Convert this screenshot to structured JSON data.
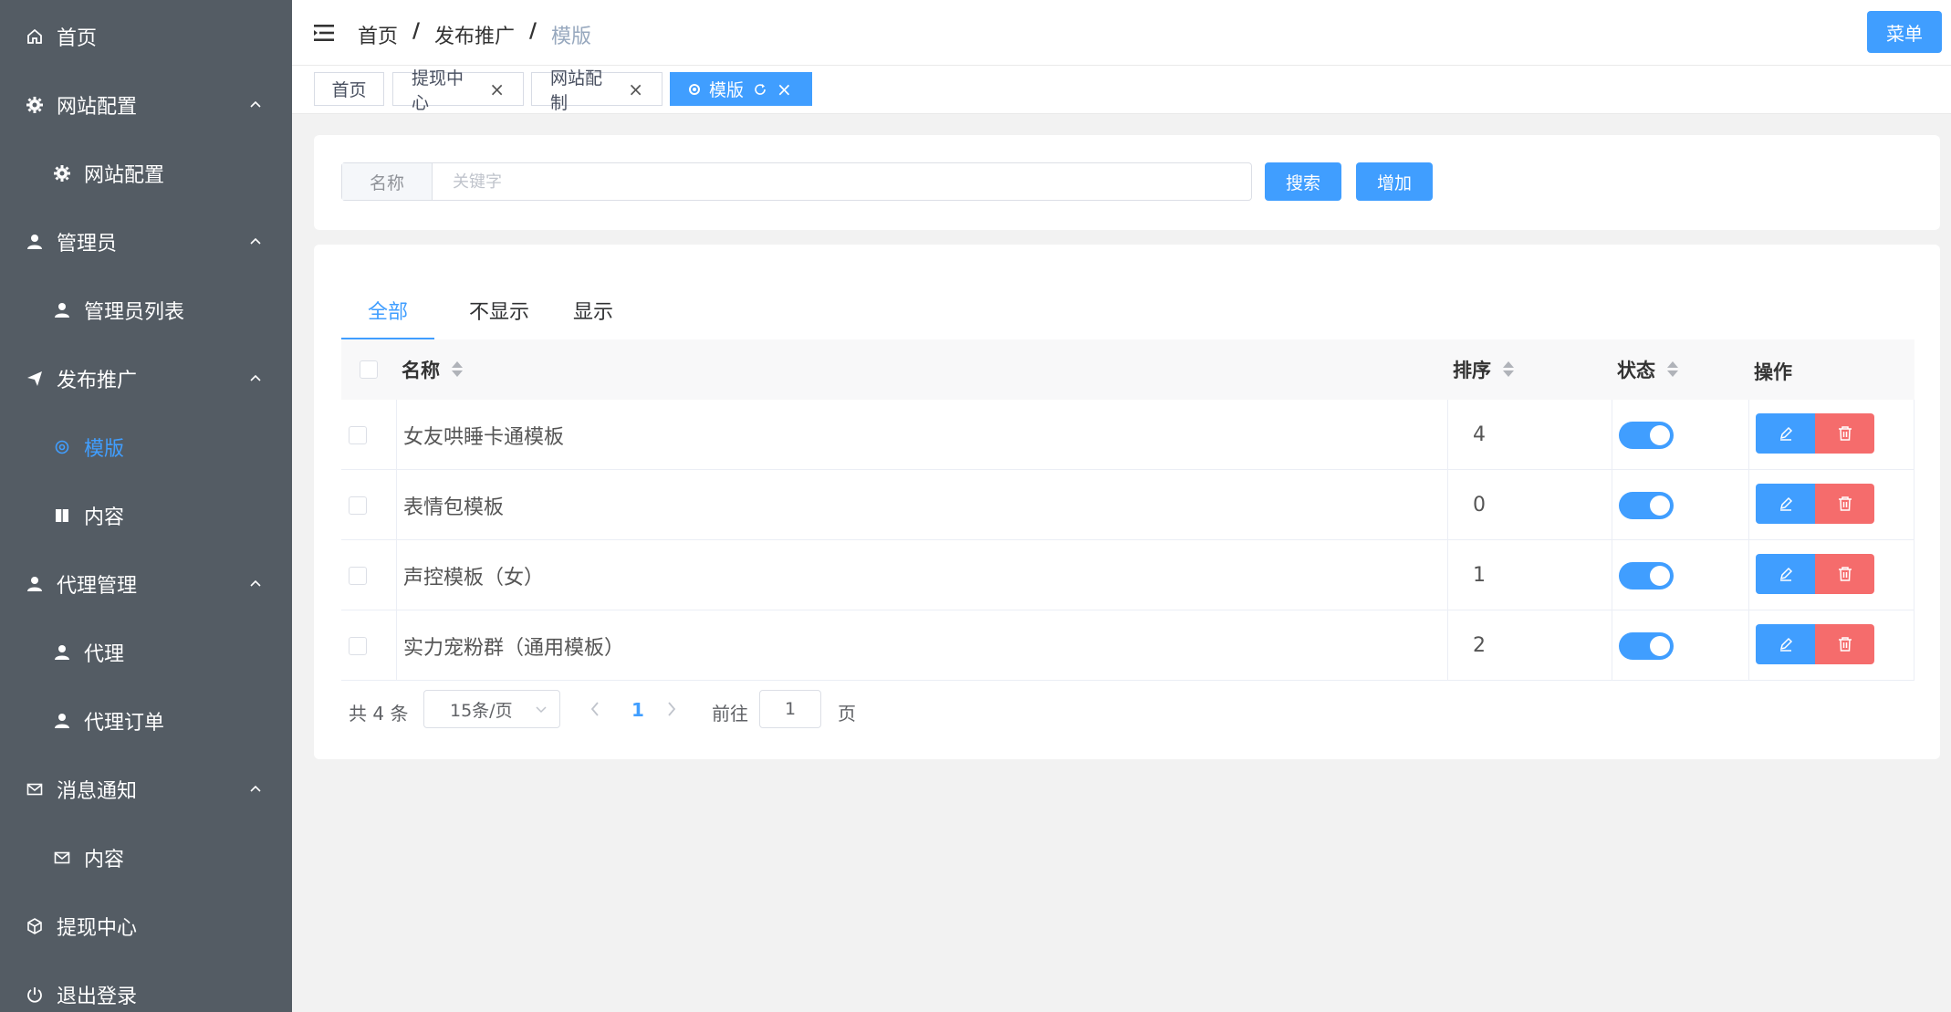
{
  "sidebar": {
    "items": [
      {
        "label": "首页"
      },
      {
        "label": "网站配置"
      },
      {
        "label": "网站配置"
      },
      {
        "label": "管理员"
      },
      {
        "label": "管理员列表"
      },
      {
        "label": "发布推广"
      },
      {
        "label": "模版"
      },
      {
        "label": "内容"
      },
      {
        "label": "代理管理"
      },
      {
        "label": "代理"
      },
      {
        "label": "代理订单"
      },
      {
        "label": "消息通知"
      },
      {
        "label": "内容"
      },
      {
        "label": "提现中心"
      },
      {
        "label": "退出登录"
      }
    ]
  },
  "header": {
    "breadcrumb": [
      "首页",
      "发布推广",
      "模版"
    ],
    "menu_label": "菜单"
  },
  "tags": [
    {
      "label": "首页"
    },
    {
      "label": "提现中心"
    },
    {
      "label": "网站配制"
    },
    {
      "label": "模版"
    }
  ],
  "search": {
    "label": "名称",
    "placeholder": "关键字",
    "search_label": "搜索",
    "add_label": "增加"
  },
  "tabs": [
    {
      "label": "全部"
    },
    {
      "label": "不显示"
    },
    {
      "label": "显示"
    }
  ],
  "table": {
    "columns": {
      "name": "名称",
      "sort": "排序",
      "status": "状态",
      "actions": "操作"
    },
    "rows": [
      {
        "name": "女友哄睡卡通模板",
        "sort": "4",
        "status": true
      },
      {
        "name": "表情包模板",
        "sort": "0",
        "status": true
      },
      {
        "name": "声控模板（女）",
        "sort": "1",
        "status": true
      },
      {
        "name": "实力宠粉群（通用模板）",
        "sort": "2",
        "status": true
      }
    ]
  },
  "pagination": {
    "total": "共 4 条",
    "page_size": "15条/页",
    "current": "1",
    "goto": "前往",
    "goto_value": "1",
    "unit": "页"
  },
  "colors": {
    "sidebar_bg": "#545c64",
    "primary": "#409eff",
    "danger": "#f56c6c"
  }
}
